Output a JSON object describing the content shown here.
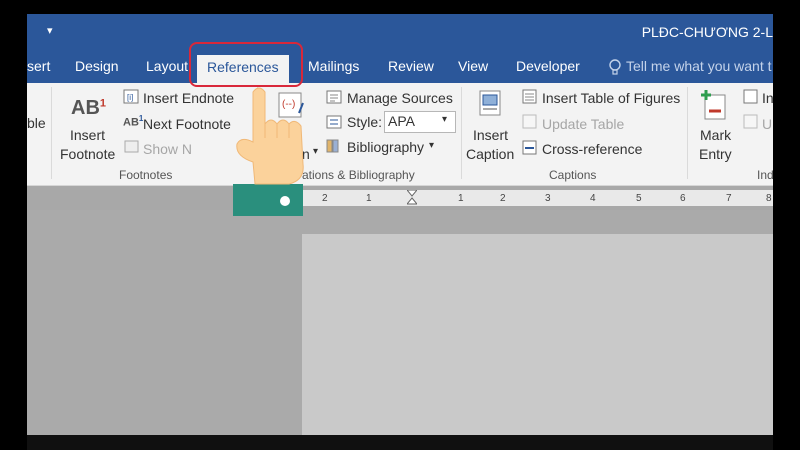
{
  "window": {
    "title": "PLĐC-CHƯƠNG 2-L"
  },
  "tabs": [
    {
      "label": "sert"
    },
    {
      "label": "Design"
    },
    {
      "label": "Layout"
    },
    {
      "label": "References",
      "active": true
    },
    {
      "label": "Mailings"
    },
    {
      "label": "Review"
    },
    {
      "label": "View"
    },
    {
      "label": "Developer"
    }
  ],
  "tell_me": {
    "label": "Tell me what you want t",
    "icon": "lightbulb-icon"
  },
  "ribbon": {
    "partial_left": "ble",
    "footnotes": {
      "insert_footnote": [
        "Insert",
        "Footnote"
      ],
      "ab_glyph": "AB",
      "superscript": "1",
      "insert_endnote": "Insert Endnote",
      "next_footnote": "Next Footnote",
      "show_notes": "Show N",
      "group": "Footnotes"
    },
    "citations": {
      "manage_sources": "Manage Sources",
      "style_label": "Style:",
      "style_value": "APA",
      "bibliography": "Bibliography",
      "partial_t": "t",
      "partial_n": "n",
      "group": "ations & Bibliography"
    },
    "captions": {
      "insert_caption": [
        "Insert",
        "Caption"
      ],
      "insert_table_of_figures": "Insert Table of Figures",
      "update_table": "Update Table",
      "cross_reference": "Cross-reference",
      "group": "Captions"
    },
    "index": {
      "mark_entry": [
        "Mark",
        "Entry"
      ],
      "insert_partial": "In",
      "update_partial": "U",
      "group": "Ind"
    }
  },
  "ruler": {
    "ticks": [
      "2",
      "1",
      "1",
      "2",
      "3",
      "4",
      "5",
      "6",
      "7",
      "8"
    ]
  },
  "colors": {
    "brand": "#2b579a",
    "highlight": "#d9283a",
    "cuff": "#2a8f7d",
    "hand": "#fbd29b"
  }
}
